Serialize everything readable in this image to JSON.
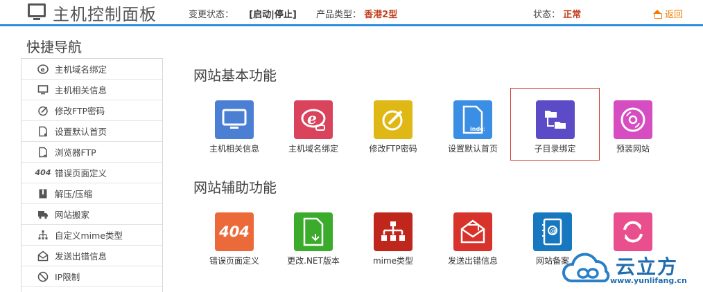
{
  "header": {
    "title": "主机控制面板",
    "change_status_label": "变更状态：",
    "change_status_value": "[启动|停止]",
    "product_type_label": "产品类型：",
    "product_type_value": "香港2型",
    "status_label": "状态：",
    "status_value": "正常",
    "back_label": "返回"
  },
  "sidebar": {
    "title": "快捷导航",
    "items": [
      {
        "label": "主机域名绑定",
        "icon": "domain-icon"
      },
      {
        "label": "主机相关信息",
        "icon": "monitor-icon"
      },
      {
        "label": "修改FTP密码",
        "icon": "edit-icon"
      },
      {
        "label": "设置默认首页",
        "icon": "document-icon"
      },
      {
        "label": "浏览器FTP",
        "icon": "document-arrow-icon"
      },
      {
        "label": "错误页面定义",
        "icon": "error-404-icon",
        "icon_text": "404"
      },
      {
        "label": "解压/压缩",
        "icon": "archive-icon"
      },
      {
        "label": "网站搬家",
        "icon": "truck-icon"
      },
      {
        "label": "自定义mime类型",
        "icon": "tree-icon"
      },
      {
        "label": "发送出错信息",
        "icon": "mail-icon"
      },
      {
        "label": "IP限制",
        "icon": "ban-icon"
      }
    ]
  },
  "main": {
    "basic": {
      "title": "网站基本功能",
      "items": [
        {
          "label": "主机相关信息",
          "icon": "monitor-icon",
          "color": "#4a7fd4"
        },
        {
          "label": "主机域名绑定",
          "icon": "domain-icon",
          "color": "#d9435b"
        },
        {
          "label": "修改FTP密码",
          "icon": "edit-icon",
          "color": "#e0b815"
        },
        {
          "label": "设置默认首页",
          "icon": "index-page-icon",
          "color": "#3a8ee3",
          "icon_text": "index"
        },
        {
          "label": "子目录绑定",
          "icon": "folder-tree-icon",
          "color": "#5b4bc7"
        },
        {
          "label": "预装网站",
          "icon": "disc-icon",
          "color": "#d64cc1"
        }
      ]
    },
    "aux": {
      "title": "网站辅助功能",
      "items": [
        {
          "label": "错误页面定义",
          "icon": "error-404-icon",
          "color": "#ec6a3a",
          "icon_text": "404"
        },
        {
          "label": "更改.NET版本",
          "icon": "document-switch-icon",
          "color": "#3aab2b"
        },
        {
          "label": "mime类型",
          "icon": "tree-icon",
          "color": "#c0271c"
        },
        {
          "label": "发送出错信息",
          "icon": "mail-icon",
          "color": "#d8322c"
        },
        {
          "label": "网站备案",
          "icon": "contact-book-icon",
          "color": "#1777bf"
        },
        {
          "label": "",
          "icon": "refresh-icon",
          "color": "#ea4f8d"
        }
      ]
    }
  },
  "watermark": {
    "name": "云立方",
    "url": "www.yunlifang.cn"
  }
}
